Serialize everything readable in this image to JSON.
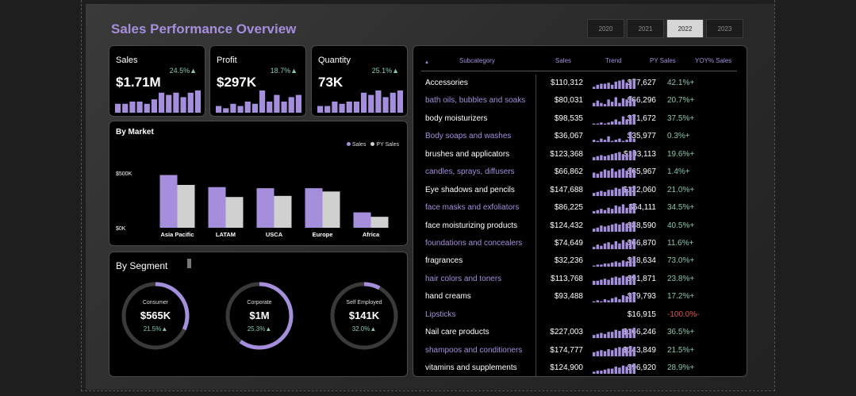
{
  "title": "Sales Performance Overview",
  "years": [
    "2020",
    "2021",
    "2022",
    "2023"
  ],
  "active_year": "2022",
  "kpis": [
    {
      "label": "Sales",
      "value": "$1.71M",
      "pct": "24.5%▲",
      "bars": [
        4,
        4,
        5,
        5,
        4,
        6,
        9,
        8,
        9,
        7,
        9,
        10
      ]
    },
    {
      "label": "Profit",
      "value": "$297K",
      "pct": "18.7%▲",
      "bars": [
        3,
        2,
        4,
        3,
        5,
        4,
        10,
        5,
        8,
        5,
        7,
        8
      ]
    },
    {
      "label": "Quantity",
      "value": "73K",
      "pct": "25.1%▲",
      "bars": [
        3,
        3,
        5,
        4,
        5,
        5,
        9,
        8,
        10,
        7,
        9,
        10
      ]
    }
  ],
  "market": {
    "title": "By Market",
    "legend": [
      "Sales",
      "PY Sales"
    ],
    "y_ticks": [
      "$500K",
      "$0K"
    ],
    "chart_data": {
      "type": "bar",
      "categories": [
        "Asia Pacific",
        "LATAM",
        "USCA",
        "Europe",
        "Africa"
      ],
      "series": [
        {
          "name": "Sales",
          "values": [
            480,
            370,
            360,
            360,
            140
          ]
        },
        {
          "name": "PY Sales",
          "values": [
            390,
            280,
            290,
            330,
            100
          ]
        }
      ],
      "ylim": [
        0,
        520
      ]
    }
  },
  "segment": {
    "title": "By Segment",
    "items": [
      {
        "label": "Consumer",
        "value": "$565K",
        "pct": "21.5%▲",
        "fraction": 0.32
      },
      {
        "label": "Corporate",
        "value": "$1M",
        "pct": "25.3%▲",
        "fraction": 0.6
      },
      {
        "label": "Self Employed",
        "value": "$141K",
        "pct": "32.0%▲",
        "fraction": 0.08
      }
    ]
  },
  "table": {
    "headers": [
      "Subcategory",
      "Sales",
      "Trend",
      "PY Sales",
      "YOY% Sales"
    ],
    "sort_glyph": "▲",
    "rows": [
      {
        "sub": "Accessories",
        "sales": "$110,312",
        "py": "$77,627",
        "yoy": "42.1%+",
        "trend": [
          2,
          4,
          5,
          5,
          6,
          4,
          7,
          8,
          9,
          6,
          8,
          10
        ]
      },
      {
        "sub": "bath oils, bubbles and soaks",
        "sales": "$80,031",
        "py": "$66,296",
        "yoy": "20.7%+",
        "trend": [
          3,
          5,
          3,
          2,
          6,
          4,
          8,
          3,
          7,
          6,
          9,
          6
        ]
      },
      {
        "sub": "body moisturizers",
        "sales": "$98,535",
        "py": "$71,672",
        "yoy": "37.5%+",
        "trend": [
          1,
          1,
          2,
          1,
          2,
          3,
          5,
          3,
          8,
          5,
          9,
          10
        ]
      },
      {
        "sub": "Body soaps and washes",
        "sales": "$36,067",
        "py": "$35,977",
        "yoy": "0.3%+",
        "trend": [
          2,
          1,
          3,
          2,
          5,
          1,
          2,
          3,
          1,
          2,
          9,
          3
        ]
      },
      {
        "sub": "brushes and applicators",
        "sales": "$123,368",
        "py": "$103,113",
        "yoy": "19.6%+",
        "trend": [
          3,
          4,
          5,
          4,
          5,
          6,
          7,
          8,
          6,
          7,
          9,
          10
        ]
      },
      {
        "sub": "candles, sprays, diffusers",
        "sales": "$66,862",
        "py": "$65,967",
        "yoy": "1.4%+",
        "trend": [
          5,
          4,
          6,
          8,
          7,
          9,
          6,
          8,
          9,
          7,
          10,
          8
        ]
      },
      {
        "sub": "Eye shadows and pencils",
        "sales": "$147,688",
        "py": "$122,060",
        "yoy": "21.0%+",
        "trend": [
          3,
          4,
          5,
          4,
          6,
          6,
          8,
          7,
          9,
          7,
          9,
          10
        ]
      },
      {
        "sub": "face masks and exfoliators",
        "sales": "$86,225",
        "py": "$64,111",
        "yoy": "34.5%+",
        "trend": [
          2,
          3,
          4,
          3,
          5,
          4,
          7,
          6,
          8,
          5,
          8,
          9
        ]
      },
      {
        "sub": "face moisturizing products",
        "sales": "$124,432",
        "py": "$88,590",
        "yoy": "40.5%+",
        "trend": [
          3,
          4,
          6,
          5,
          6,
          7,
          8,
          7,
          9,
          8,
          9,
          10
        ]
      },
      {
        "sub": "foundations and concealers",
        "sales": "$74,649",
        "py": "$66,870",
        "yoy": "11.6%+",
        "trend": [
          2,
          4,
          3,
          5,
          6,
          4,
          7,
          5,
          8,
          6,
          8,
          9
        ]
      },
      {
        "sub": "fragrances",
        "sales": "$32,236",
        "py": "$18,634",
        "yoy": "73.0%+",
        "trend": [
          1,
          2,
          2,
          3,
          3,
          4,
          5,
          4,
          6,
          5,
          8,
          10
        ]
      },
      {
        "sub": "hair colors and toners",
        "sales": "$113,768",
        "py": "$91,871",
        "yoy": "23.8%+",
        "trend": [
          4,
          4,
          5,
          6,
          5,
          7,
          8,
          7,
          9,
          8,
          9,
          10
        ]
      },
      {
        "sub": "hand creams",
        "sales": "$93,488",
        "py": "$79,793",
        "yoy": "17.2%+",
        "trend": [
          1,
          2,
          1,
          3,
          2,
          4,
          5,
          3,
          7,
          6,
          9,
          10
        ]
      },
      {
        "sub": "Lipsticks",
        "sales": "",
        "py": "$16,915",
        "yoy": "-100.0%-",
        "trend": []
      },
      {
        "sub": "Nail care products",
        "sales": "$227,003",
        "py": "$166,246",
        "yoy": "36.5%+",
        "trend": [
          3,
          4,
          5,
          4,
          6,
          6,
          8,
          7,
          9,
          8,
          9,
          10
        ]
      },
      {
        "sub": "shampoos and conditioners",
        "sales": "$174,777",
        "py": "$143,849",
        "yoy": "21.5%+",
        "trend": [
          4,
          5,
          6,
          5,
          7,
          6,
          8,
          9,
          8,
          9,
          10,
          9
        ]
      },
      {
        "sub": "vitamins and supplements",
        "sales": "$124,900",
        "py": "$96,920",
        "yoy": "28.9%+",
        "trend": [
          2,
          3,
          3,
          4,
          5,
          5,
          7,
          6,
          8,
          7,
          9,
          10
        ]
      }
    ]
  },
  "colors": {
    "accent": "#a58fdc",
    "gray": "#d0d0d0",
    "positive": "#88c8b0",
    "negative": "#e05050"
  }
}
